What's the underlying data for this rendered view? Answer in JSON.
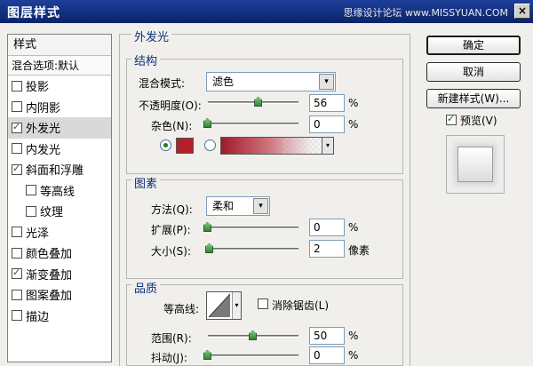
{
  "window": {
    "title": "图层样式",
    "watermark": "思缘设计论坛 www.MISSYUAN.COM",
    "close_label": "×"
  },
  "style_list": {
    "header": "样式",
    "blend_options": "混合选项:默认",
    "items": [
      {
        "label": "投影",
        "checked": false,
        "selected": false
      },
      {
        "label": "内阴影",
        "checked": false,
        "selected": false
      },
      {
        "label": "外发光",
        "checked": true,
        "selected": true
      },
      {
        "label": "内发光",
        "checked": false,
        "selected": false
      },
      {
        "label": "斜面和浮雕",
        "checked": true,
        "selected": false
      },
      {
        "label": "等高线",
        "checked": false,
        "selected": false,
        "sub": true
      },
      {
        "label": "纹理",
        "checked": false,
        "selected": false,
        "sub": true
      },
      {
        "label": "光泽",
        "checked": false,
        "selected": false
      },
      {
        "label": "颜色叠加",
        "checked": false,
        "selected": false
      },
      {
        "label": "渐变叠加",
        "checked": true,
        "selected": false
      },
      {
        "label": "图案叠加",
        "checked": false,
        "selected": false
      },
      {
        "label": "描边",
        "checked": false,
        "selected": false
      }
    ]
  },
  "panel": {
    "title": "外发光",
    "structure": {
      "title": "结构",
      "blend_mode_label": "混合模式:",
      "blend_mode_value": "滤色",
      "opacity_label": "不透明度(O):",
      "opacity_value": "56",
      "opacity_unit": "%",
      "opacity_level": 0.56,
      "noise_label": "杂色(N):",
      "noise_value": "0",
      "noise_unit": "%",
      "noise_level": 0,
      "color": "#b3202a",
      "color_mode": "solid"
    },
    "elements": {
      "title": "图素",
      "technique_label": "方法(Q):",
      "technique_value": "柔和",
      "spread_label": "扩展(P):",
      "spread_value": "0",
      "spread_unit": "%",
      "spread_level": 0,
      "size_label": "大小(S):",
      "size_value": "2",
      "size_unit": "像素",
      "size_level": 0.02
    },
    "quality": {
      "title": "品质",
      "contour_label": "等高线:",
      "antialias_label": "消除锯齿(L)",
      "antialias_checked": false,
      "range_label": "范围(R):",
      "range_value": "50",
      "range_unit": "%",
      "range_level": 0.5,
      "jitter_label": "抖动(J):",
      "jitter_value": "0",
      "jitter_unit": "%",
      "jitter_level": 0
    }
  },
  "buttons": {
    "ok": "确定",
    "cancel": "取消",
    "new_style": "新建样式(W)...",
    "preview_label": "预览(V)",
    "preview_checked": true
  },
  "icons": {
    "dropdown": "▾",
    "close": "close-icon"
  }
}
